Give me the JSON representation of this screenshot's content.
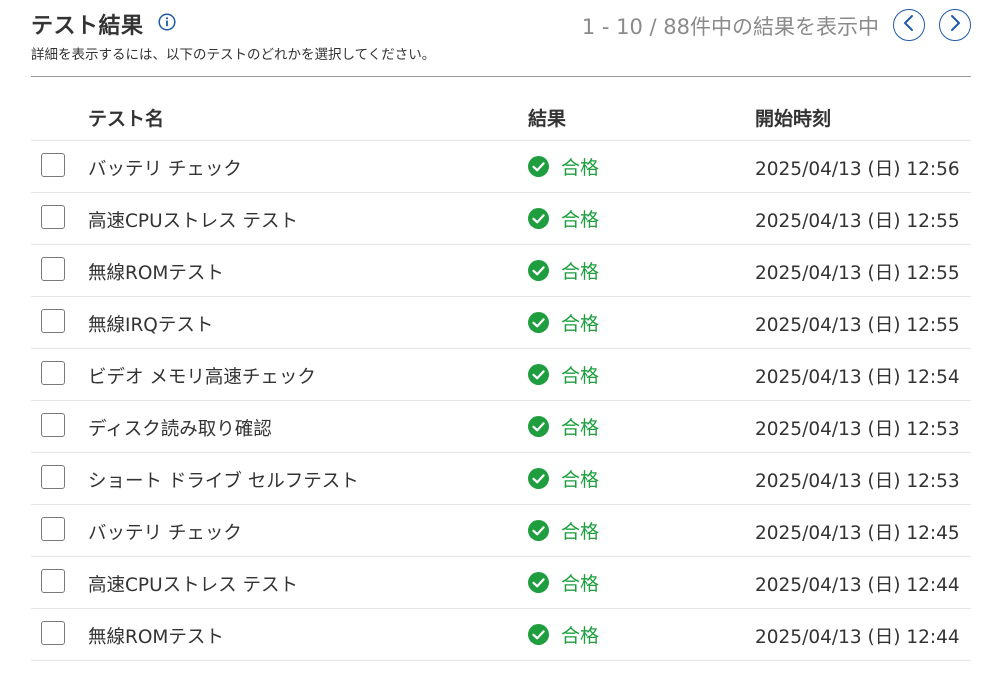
{
  "header": {
    "title": "テスト結果",
    "subtitle": "詳細を表示するには、以下のテストのどれかを選択してください。",
    "pager_text": "1 - 10 / 88件中の結果を表示中"
  },
  "icons": {
    "info": "info-icon",
    "prev": "chevron-left-icon",
    "next": "chevron-right-icon",
    "pass": "check-circle-icon"
  },
  "colors": {
    "accent": "#1e5aa8",
    "pass": "#1e9e3e",
    "pager_text": "#8a8a8a"
  },
  "table": {
    "columns": {
      "name": "テスト名",
      "result": "結果",
      "start_time": "開始時刻"
    },
    "rows": [
      {
        "name": "バッテリ チェック",
        "result": "合格",
        "start_time": "2025/04/13 (日) 12:56",
        "checked": false
      },
      {
        "name": "高速CPUストレス テスト",
        "result": "合格",
        "start_time": "2025/04/13 (日) 12:55",
        "checked": false
      },
      {
        "name": "無線ROMテスト",
        "result": "合格",
        "start_time": "2025/04/13 (日) 12:55",
        "checked": false
      },
      {
        "name": "無線IRQテスト",
        "result": "合格",
        "start_time": "2025/04/13 (日) 12:55",
        "checked": false
      },
      {
        "name": "ビデオ メモリ高速チェック",
        "result": "合格",
        "start_time": "2025/04/13 (日) 12:54",
        "checked": false
      },
      {
        "name": "ディスク読み取り確認",
        "result": "合格",
        "start_time": "2025/04/13 (日) 12:53",
        "checked": false
      },
      {
        "name": "ショート ドライブ セルフテスト",
        "result": "合格",
        "start_time": "2025/04/13 (日) 12:53",
        "checked": false
      },
      {
        "name": "バッテリ チェック",
        "result": "合格",
        "start_time": "2025/04/13 (日) 12:45",
        "checked": false
      },
      {
        "name": "高速CPUストレス テスト",
        "result": "合格",
        "start_time": "2025/04/13 (日) 12:44",
        "checked": false
      },
      {
        "name": "無線ROMテスト",
        "result": "合格",
        "start_time": "2025/04/13 (日) 12:44",
        "checked": false
      }
    ]
  }
}
